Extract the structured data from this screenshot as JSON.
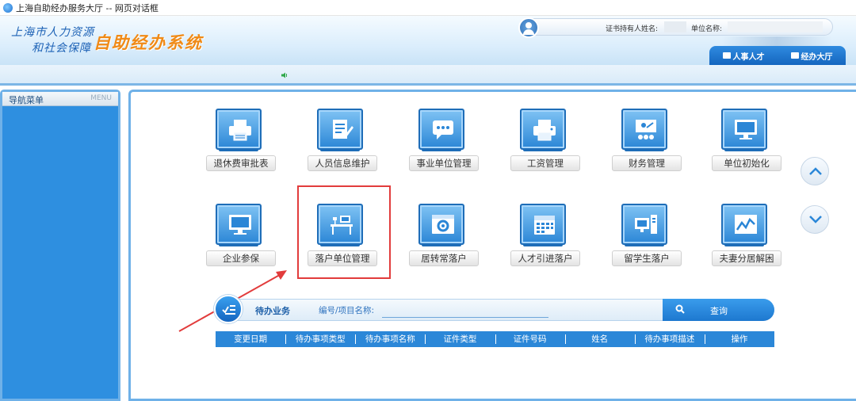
{
  "window": {
    "title": "上海自助经办服务大厅 -- 网页对话框"
  },
  "brand": {
    "line1": "上海市人力资源",
    "line2": "和社会保障",
    "system_name": "自助经办系统"
  },
  "userbar": {
    "holder_label": "证书持有人姓名:",
    "unit_label": "单位名称:"
  },
  "topnav": {
    "items": [
      {
        "label": "人事人才",
        "icon": "id-card-icon"
      },
      {
        "label": "经办大厅",
        "icon": "building-icon"
      }
    ]
  },
  "sidebar": {
    "title": "导航菜单",
    "menu_label": "MENU"
  },
  "tiles": [
    {
      "label": "退休费审批表",
      "icon": "printer-icon"
    },
    {
      "label": "人员信息维护",
      "icon": "edit-document-icon"
    },
    {
      "label": "事业单位管理",
      "icon": "chat-bubble-icon"
    },
    {
      "label": "工资管理",
      "icon": "printer-icon"
    },
    {
      "label": "财务管理",
      "icon": "presentation-icon"
    },
    {
      "label": "单位初始化",
      "icon": "monitor-icon"
    },
    {
      "label": "企业参保",
      "icon": "monitor-icon"
    },
    {
      "label": "落户单位管理",
      "icon": "desk-icon"
    },
    {
      "label": "居转常落户",
      "icon": "browser-settings-icon"
    },
    {
      "label": "人才引进落户",
      "icon": "calendar-icon"
    },
    {
      "label": "留学生落户",
      "icon": "computer-tower-icon"
    },
    {
      "label": "夫妻分居解困",
      "icon": "line-chart-icon"
    }
  ],
  "pending": {
    "title": "待办业务",
    "field_label": "编号/项目名称:",
    "input_value": "",
    "query_label": "查询",
    "columns": [
      "变更日期",
      "待办事项类型",
      "待办事项名称",
      "证件类型",
      "证件号码",
      "姓名",
      "待办事项描述",
      "操作"
    ]
  },
  "colors": {
    "accent": "#2b87d8",
    "brand_orange": "#f08a16",
    "highlight": "#e23c3c"
  }
}
